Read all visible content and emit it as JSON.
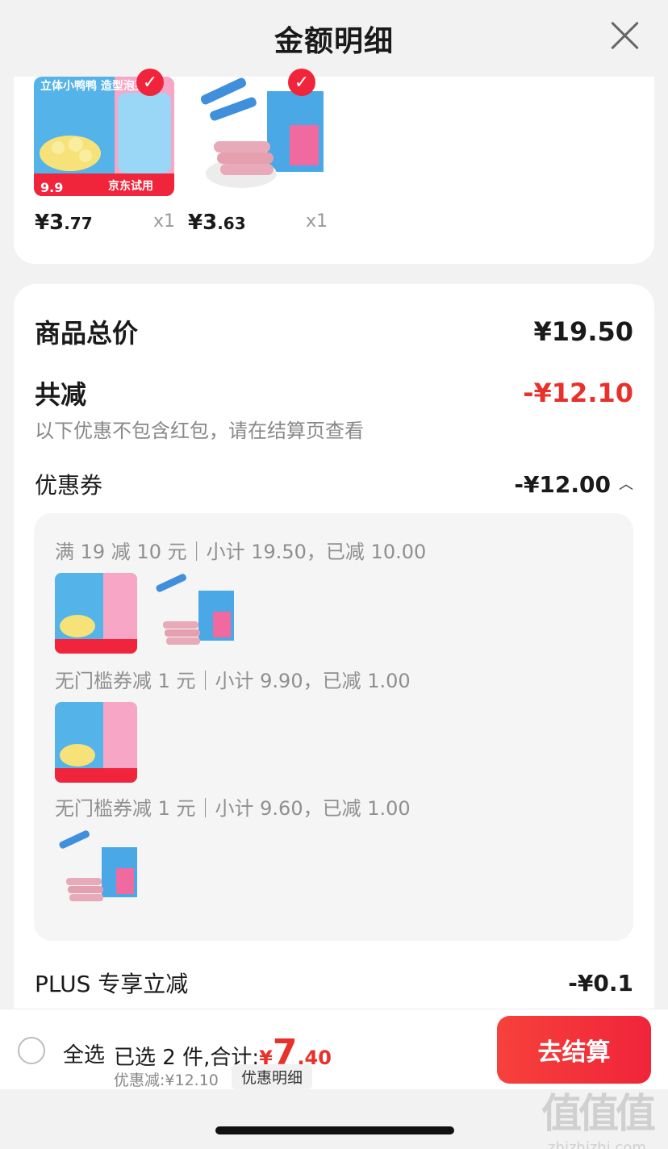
{
  "header": {
    "title": "金额明细"
  },
  "top_items": [
    {
      "price_int": "¥3",
      "price_dec": ".77",
      "qty": "x1",
      "promo_price": "9.9",
      "promo_tag": "京东试用",
      "product_title": "立体小鸭鸭 造型泡芙"
    },
    {
      "price_int": "¥3",
      "price_dec": ".63",
      "qty": "x1"
    }
  ],
  "summary": {
    "total_label": "商品总价",
    "total_value": "¥19.50",
    "reduce_label": "共减",
    "reduce_value": "-¥12.10",
    "note": "以下优惠不包含红包，请在结算页查看",
    "coupon_label": "优惠券",
    "coupon_value": "-¥12.00"
  },
  "coupons": [
    {
      "text": "满 19 减 10 元｜小计 19.50，已减 10.00"
    },
    {
      "text": "无门槛券减 1 元｜小计 9.90，已减 1.00"
    },
    {
      "text": "无门槛券减 1 元｜小计 9.60，已减 1.00"
    }
  ],
  "plus": {
    "label": "PLUS 专享立减",
    "value": "-¥0.1"
  },
  "bottom": {
    "select_all": "全选",
    "selected_text": "已选 2 件,合计:",
    "total_yen": "¥",
    "total_int": "7",
    "total_dec": ".40",
    "discount_text": "优惠减:¥12.10",
    "detail_label": "优惠明细",
    "checkout_label": "去结算"
  },
  "watermark": {
    "big": "值值值",
    "small": "zhizhizhi.com"
  },
  "colors": {
    "accent": "#e8312a",
    "button": "#f0243a"
  }
}
